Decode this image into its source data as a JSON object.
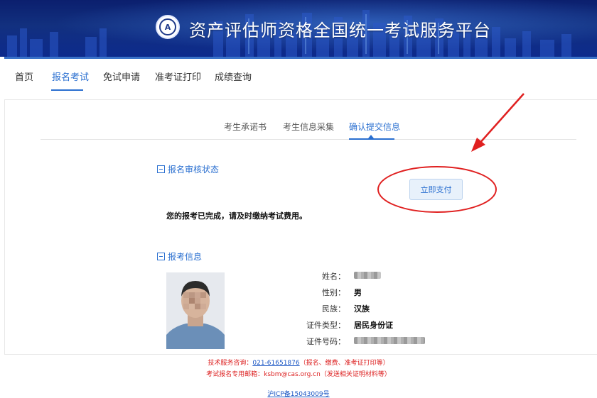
{
  "header": {
    "title": "资产评估师资格全国统一考试服务平台",
    "logo_icon": "association-seal-icon"
  },
  "nav": {
    "items": [
      {
        "label": "首页",
        "active": false
      },
      {
        "label": "报名考试",
        "active": true
      },
      {
        "label": "免试申请",
        "active": false
      },
      {
        "label": "准考证打印",
        "active": false
      },
      {
        "label": "成绩查询",
        "active": false
      }
    ]
  },
  "steps": {
    "items": [
      {
        "label": "考生承诺书",
        "active": false
      },
      {
        "label": "考生信息采集",
        "active": false
      },
      {
        "label": "确认提交信息",
        "active": true
      }
    ]
  },
  "review": {
    "section_title": "报名审核状态",
    "pay_button": "立即支付",
    "notice": "您的报考已完成，请及时缴纳考试费用。"
  },
  "info": {
    "section_title": "报考信息",
    "fields": [
      {
        "label": "姓名：",
        "value": "",
        "redacted": true
      },
      {
        "label": "性别：",
        "value": "男",
        "redacted": false
      },
      {
        "label": "民族：",
        "value": "汉族",
        "redacted": false
      },
      {
        "label": "证件类型：",
        "value": "居民身份证",
        "redacted": false
      },
      {
        "label": "证件号码：",
        "value": "",
        "redacted": true
      }
    ]
  },
  "footer": {
    "support_prefix": "技术服务咨询：",
    "support_phone": "021-61651876",
    "support_suffix": "（报名、缴费、准考证打印等）",
    "email_prefix": "考试报名专用邮箱：",
    "email": "ksbm@cas.org.cn",
    "email_suffix": "（发送相关证明材料等）",
    "icp": "沪ICP备15043009号"
  },
  "colors": {
    "accent": "#2a6fd0",
    "banner": "#12307f",
    "annotation": "#e02020",
    "footer_text": "#d22222"
  }
}
